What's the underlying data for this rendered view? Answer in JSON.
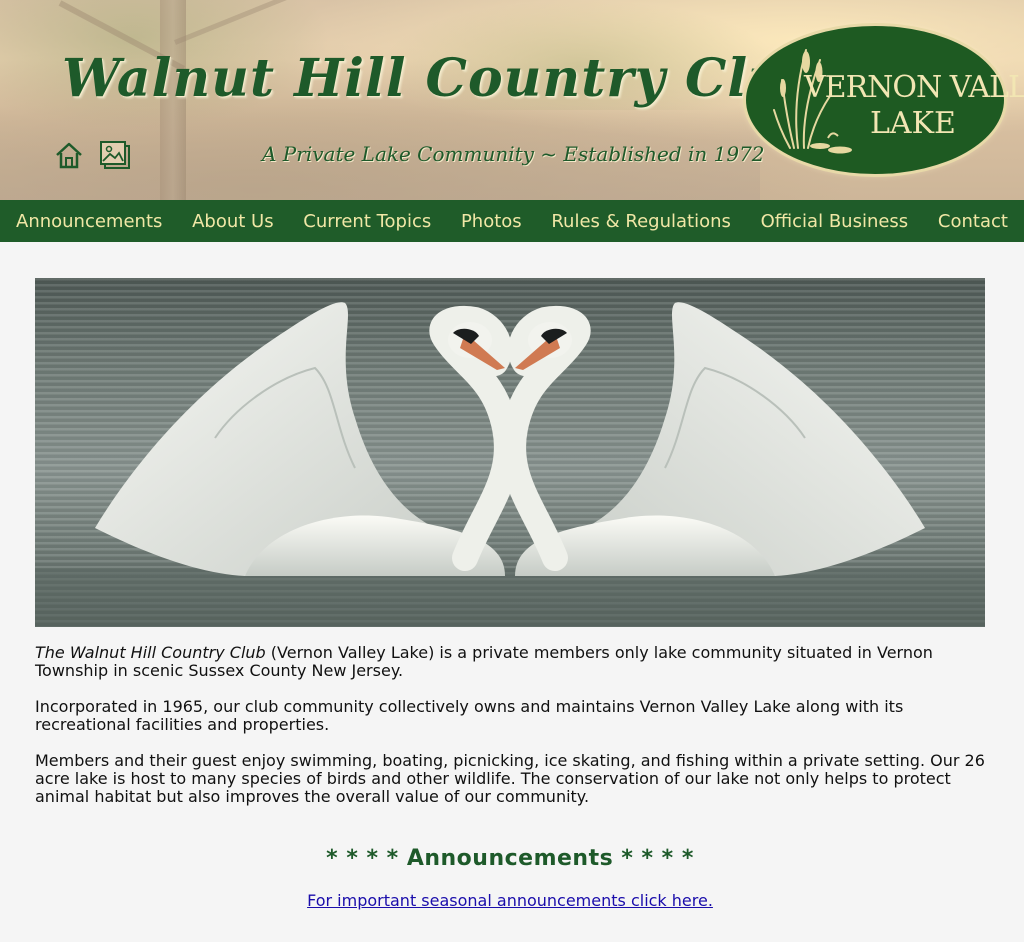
{
  "header": {
    "title": "Walnut Hill Country Club",
    "tagline": "A Private Lake Community ~ Established in 1972",
    "logo": {
      "line1": "VERNON VALLEY",
      "line2": "LAKE"
    },
    "icons": [
      "home-icon",
      "gallery-icon"
    ]
  },
  "nav": {
    "items": [
      {
        "label": "Announcements"
      },
      {
        "label": "About Us"
      },
      {
        "label": "Current Topics"
      },
      {
        "label": "Photos"
      },
      {
        "label": "Rules & Regulations"
      },
      {
        "label": "Official Business"
      },
      {
        "label": "Contact"
      }
    ]
  },
  "intro": {
    "p1_club": "The Walnut Hill Country Club",
    "p1_rest": " (Vernon Valley Lake) is a private members only lake community situated in Vernon Township in scenic Sussex County New Jersey.",
    "p2": "Incorporated in 1965, our club community collectively owns and maintains Vernon Valley Lake along with its recreational facilities and properties.",
    "p3": "Members and their guest enjoy swimming, boating, picnicking, ice skating, and fishing within a private setting. Our 26 acre lake is host to many species of birds and other wildlife. The conservation of our lake not only helps to protect animal habitat but also improves the overall value of our community."
  },
  "announcements": {
    "heading": "* * * * Announcements * * * *",
    "link": "For important seasonal announcements click here."
  },
  "colors": {
    "nav_bg": "#1f5c29",
    "nav_text": "#f0e7a6",
    "title_green": "#1e5a2a",
    "link_blue": "#1a0dab",
    "page_bg": "#f5f5f5"
  }
}
